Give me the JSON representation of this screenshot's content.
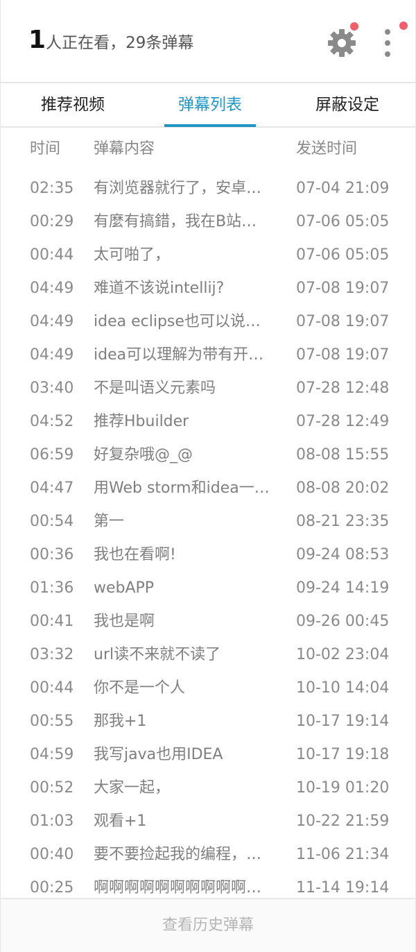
{
  "header": {
    "viewer_count": "1",
    "viewer_text": "人正在看，29条弹幕",
    "settings_icon": "gear-icon",
    "more_icon": "more-vertical-icon",
    "notification_dot_color": "#f25d6b"
  },
  "tabs": [
    {
      "label": "推荐视频",
      "active": false
    },
    {
      "label": "弹幕列表",
      "active": true
    },
    {
      "label": "屏蔽设定",
      "active": false
    }
  ],
  "accent_color": "#1e97c6",
  "columns": {
    "time": "时间",
    "content": "弹幕内容",
    "sent": "发送时间"
  },
  "rows": [
    {
      "time": "02:35",
      "content": "有浏览器就行了，安卓…",
      "sent": "07-04 21:09"
    },
    {
      "time": "00:29",
      "content": "有麼有搞錯，我在B站…",
      "sent": "07-06 05:05"
    },
    {
      "time": "00:44",
      "content": "太可啪了，",
      "sent": "07-06 05:05"
    },
    {
      "time": "04:49",
      "content": "难道不该说intellij?",
      "sent": "07-08 19:07"
    },
    {
      "time": "04:49",
      "content": "idea eclipse也可以说…",
      "sent": "07-08 19:07"
    },
    {
      "time": "04:49",
      "content": "idea可以理解为带有开…",
      "sent": "07-08 19:07"
    },
    {
      "time": "03:40",
      "content": "不是叫语义元素吗",
      "sent": "07-28 12:48"
    },
    {
      "time": "04:52",
      "content": "推荐Hbuilder",
      "sent": "07-28 12:49"
    },
    {
      "time": "06:59",
      "content": "好复杂哦@_@",
      "sent": "08-08 15:55"
    },
    {
      "time": "04:47",
      "content": "用Web storm和idea一…",
      "sent": "08-08 20:02"
    },
    {
      "time": "00:54",
      "content": "第一",
      "sent": "08-21 23:35"
    },
    {
      "time": "00:36",
      "content": "我也在看啊!",
      "sent": "09-24 08:53"
    },
    {
      "time": "01:36",
      "content": "webAPP",
      "sent": "09-24 14:19"
    },
    {
      "time": "00:41",
      "content": "我也是啊",
      "sent": "09-26 00:45"
    },
    {
      "time": "03:32",
      "content": "url读不来就不读了",
      "sent": "10-02 23:04"
    },
    {
      "time": "00:44",
      "content": "你不是一个人",
      "sent": "10-10 14:04"
    },
    {
      "time": "00:55",
      "content": "那我+1",
      "sent": "10-17 19:14"
    },
    {
      "time": "04:59",
      "content": "我写java也用IDEA",
      "sent": "10-17 19:18"
    },
    {
      "time": "00:52",
      "content": "大家一起，",
      "sent": "10-19 01:20"
    },
    {
      "time": "01:03",
      "content": "观看+1",
      "sent": "10-22 21:59"
    },
    {
      "time": "00:40",
      "content": "要不要捡起我的编程，…",
      "sent": "11-06 21:34"
    },
    {
      "time": "00:25",
      "content": "啊啊啊啊啊啊啊啊啊啊…",
      "sent": "11-14 19:14"
    }
  ],
  "footer": {
    "history_label": "查看历史弹幕"
  }
}
